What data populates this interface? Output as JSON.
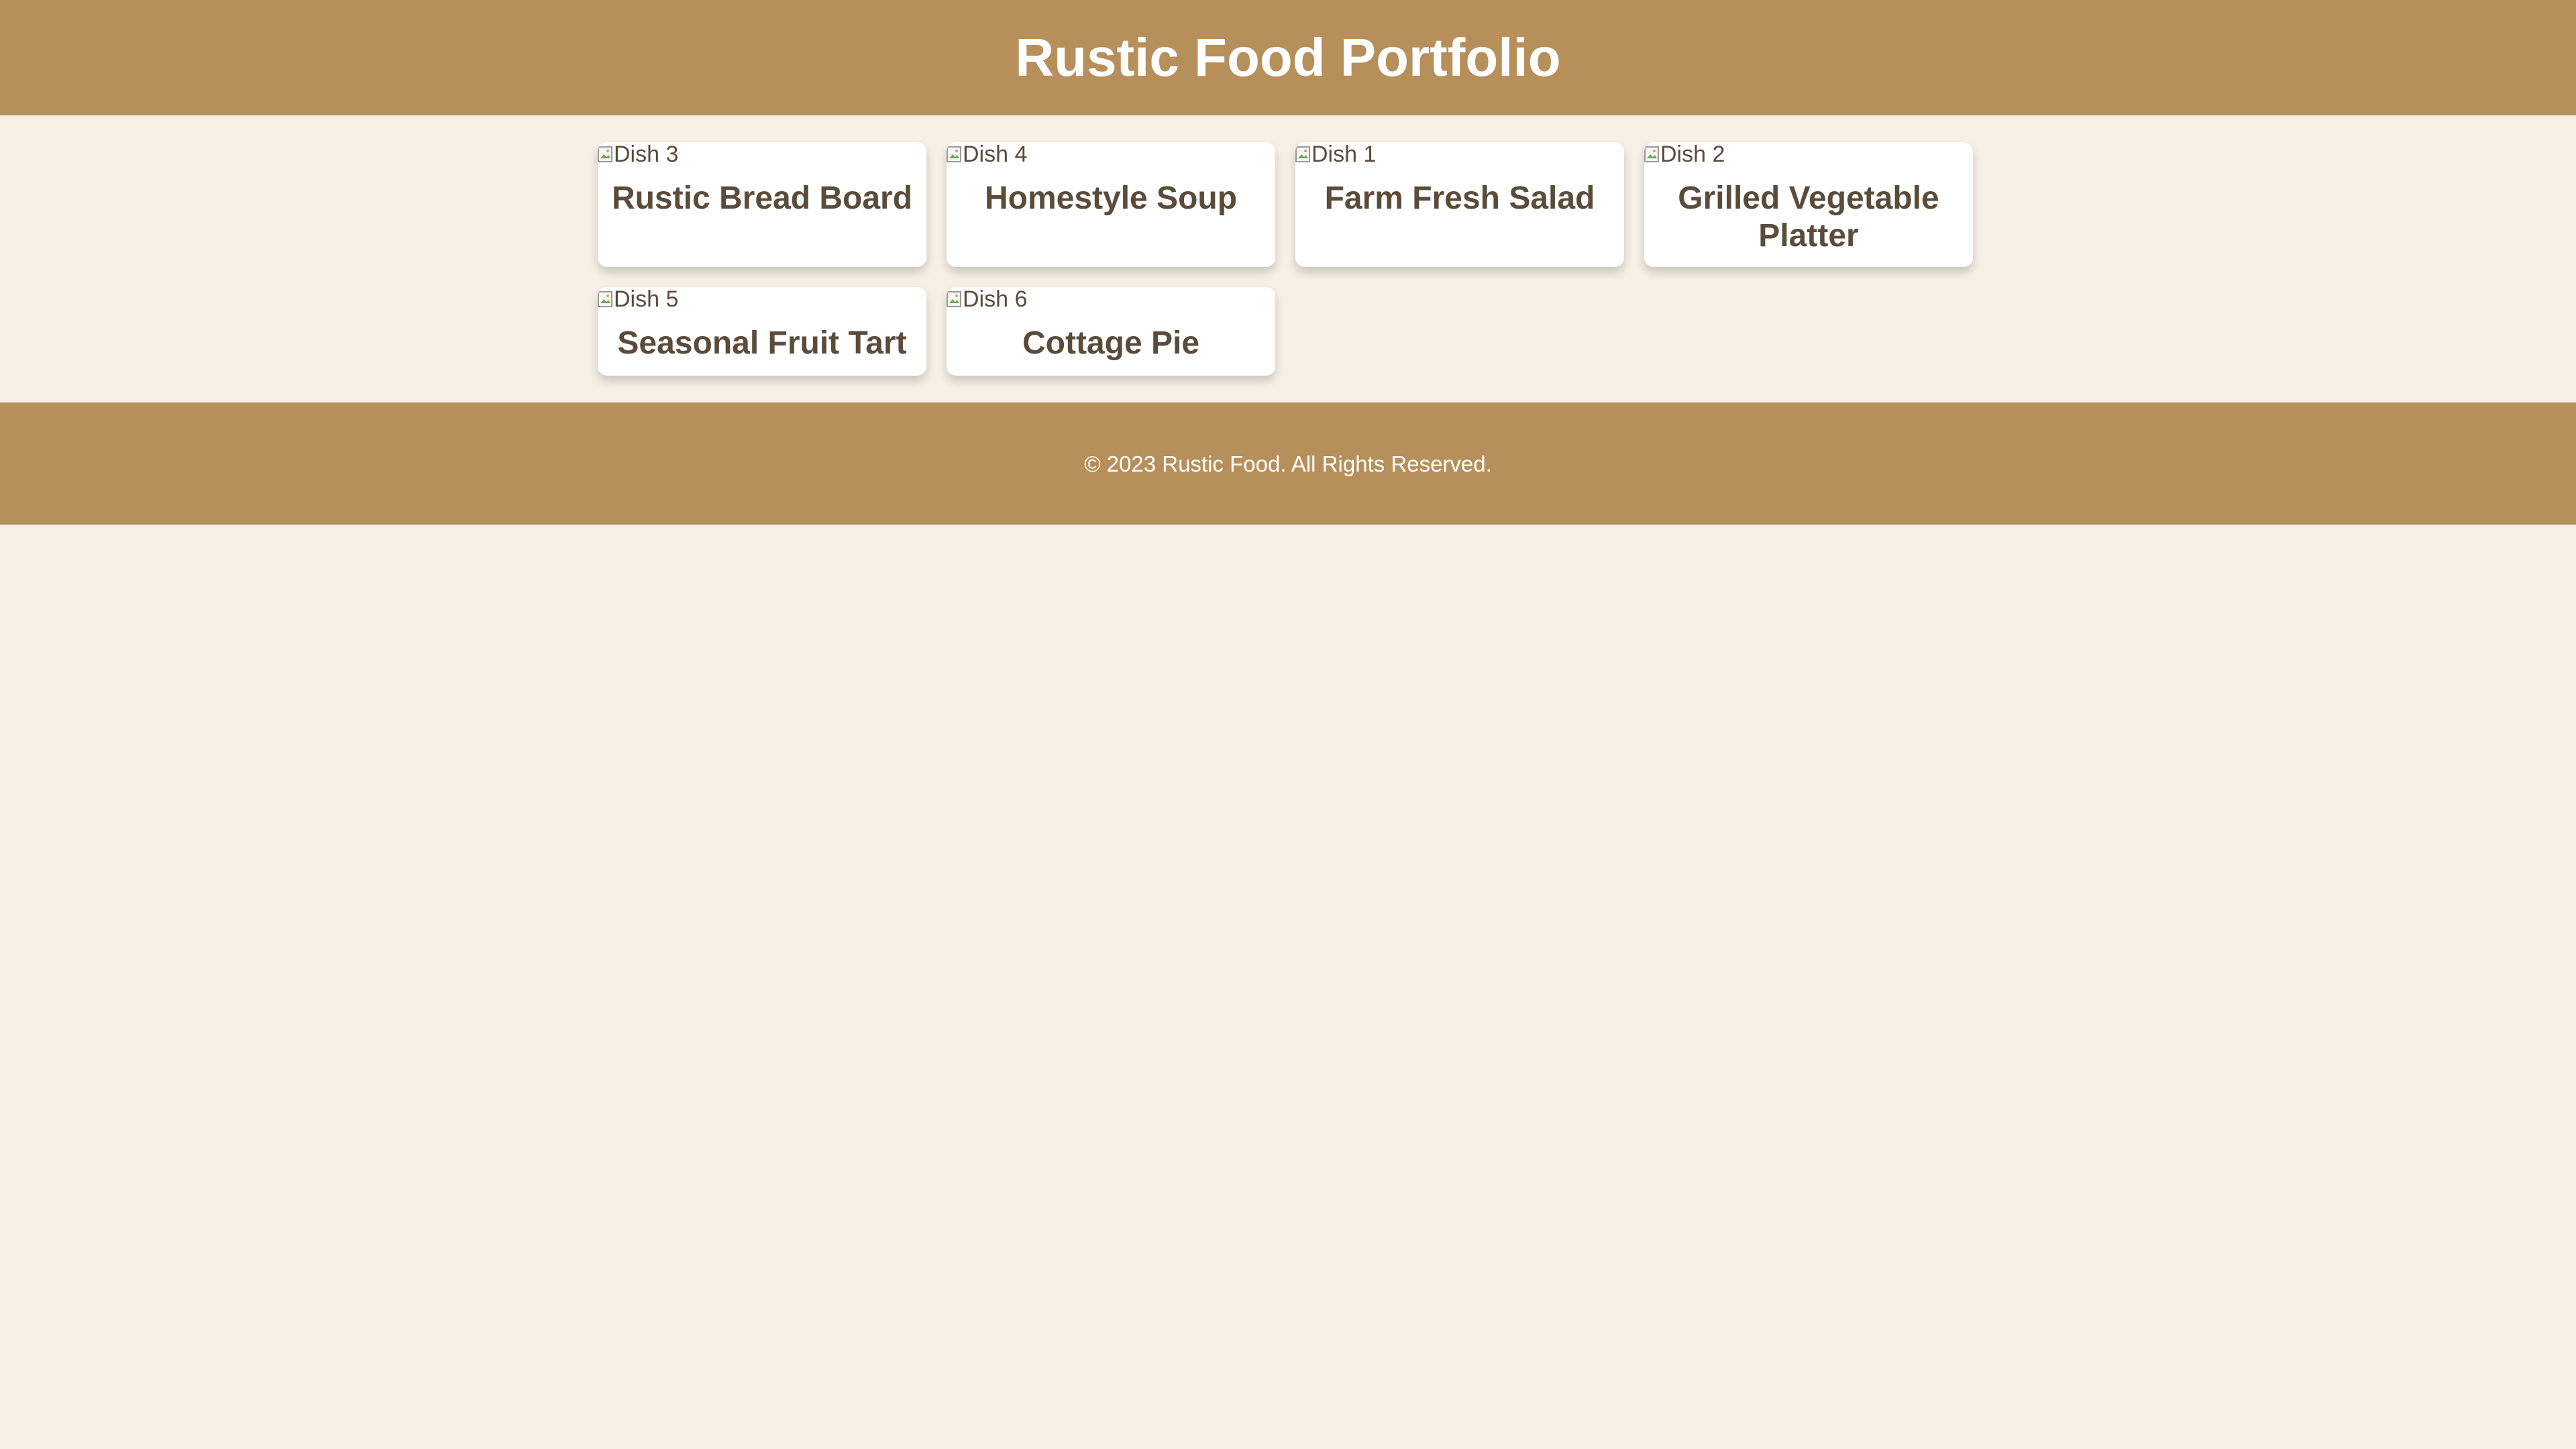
{
  "header": {
    "title": "Rustic Food Portfolio"
  },
  "gallery": {
    "items": [
      {
        "image_alt": "Dish 3",
        "title": "Rustic Bread Board"
      },
      {
        "image_alt": "Dish 4",
        "title": "Homestyle Soup"
      },
      {
        "image_alt": "Dish 1",
        "title": "Farm Fresh Salad"
      },
      {
        "image_alt": "Dish 2",
        "title": "Grilled Vegetable Platter"
      },
      {
        "image_alt": "Dish 5",
        "title": "Seasonal Fruit Tart"
      },
      {
        "image_alt": "Dish 6",
        "title": "Cottage Pie"
      }
    ]
  },
  "footer": {
    "text": "© 2023 Rustic Food. All Rights Reserved."
  },
  "colors": {
    "header_background": "#b78f5a",
    "page_background": "#f7f0e6",
    "card_background": "#ffffff",
    "text": "#5b4b3a",
    "header_text": "#ffffff"
  },
  "icons": {
    "image_placeholder": "broken-image-icon"
  }
}
